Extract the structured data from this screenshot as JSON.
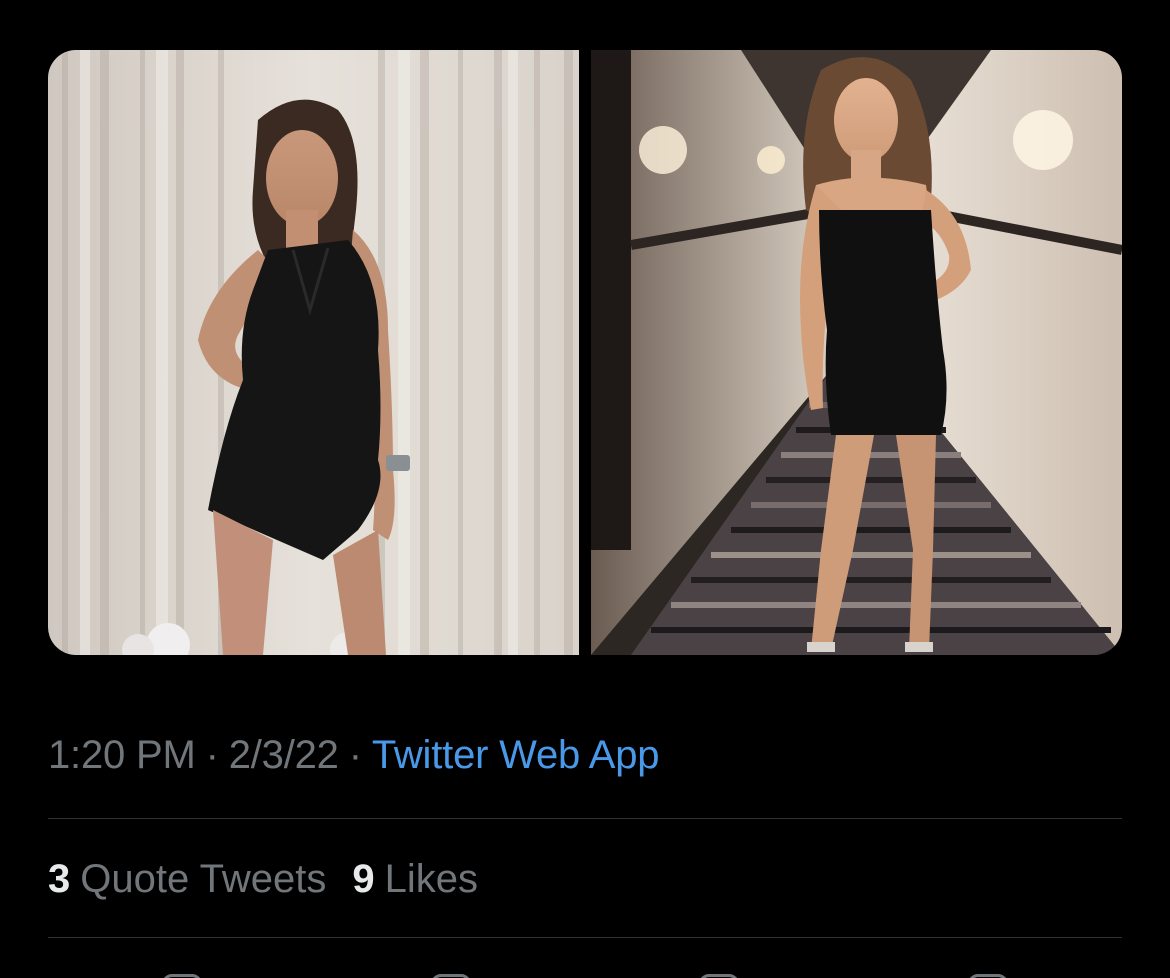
{
  "media": {
    "items": [
      {
        "label": "photo-1",
        "scene": "curtain-backdrop"
      },
      {
        "label": "photo-2",
        "scene": "hotel-hallway"
      }
    ]
  },
  "tweet_meta": {
    "time": "1:20 PM",
    "separator": "·",
    "date": "2/3/22",
    "source": "Twitter Web App"
  },
  "stats": {
    "quote_tweets": {
      "count": "3",
      "label": "Quote Tweets"
    },
    "likes": {
      "count": "9",
      "label": "Likes"
    }
  },
  "actions": [
    {
      "icon": "reply-icon"
    },
    {
      "icon": "retweet-icon"
    },
    {
      "icon": "like-icon"
    },
    {
      "icon": "share-icon"
    }
  ],
  "colors": {
    "background": "#000000",
    "link": "#4a99e9",
    "secondary_text": "#71767b",
    "primary_text": "#e7e9ea",
    "divider": "#2f3336"
  }
}
